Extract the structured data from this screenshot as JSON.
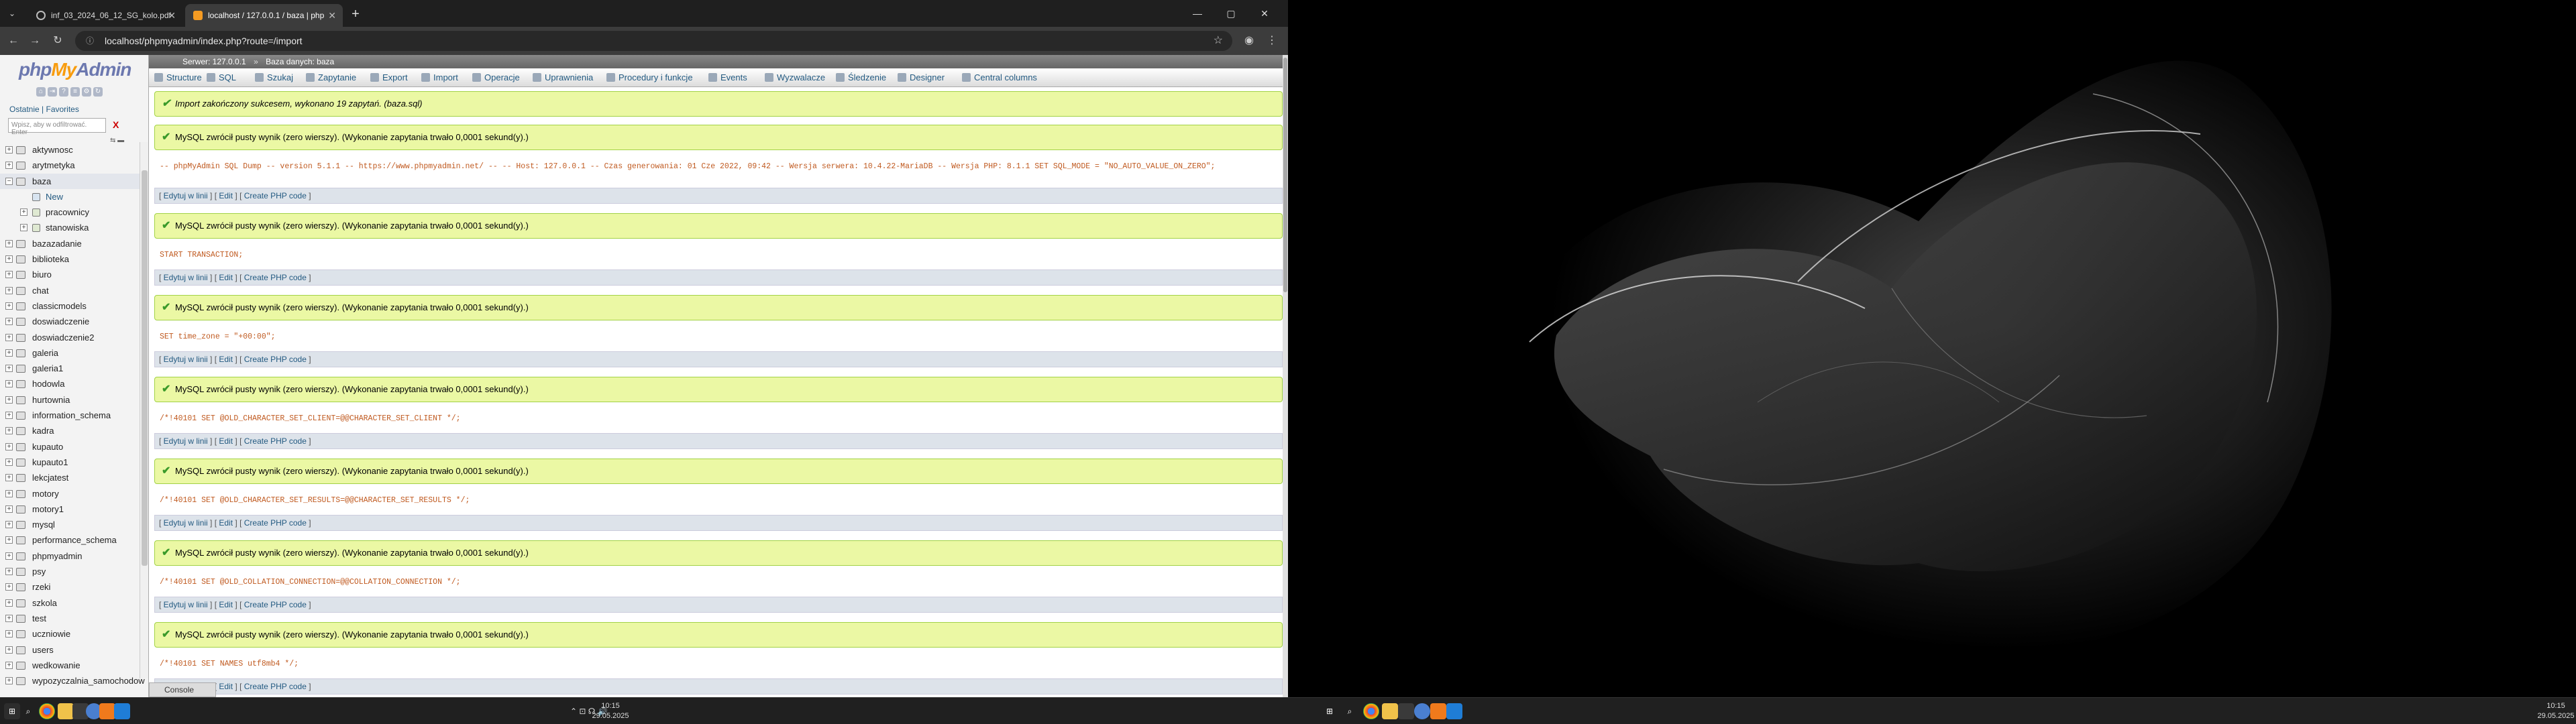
{
  "browser": {
    "tabs": [
      {
        "title": "inf_03_2024_06_12_SG_kolo.pdf"
      },
      {
        "title": "localhost / 127.0.0.1 / baza | php"
      }
    ],
    "url": "localhost/phpmyadmin/index.php?route=/import"
  },
  "sidebar": {
    "logo_php": "php",
    "logo_my": "My",
    "logo_admin": "Admin",
    "tab_recent": "Ostatnie",
    "tab_favorites": "Favorites",
    "filter_placeholder": "Wpisz, aby w odfiltrować. Enter",
    "filter_clear": "X",
    "databases": [
      {
        "name": "aktywnosc",
        "type": "db"
      },
      {
        "name": "arytmetyka",
        "type": "db"
      },
      {
        "name": "baza",
        "type": "db",
        "selected": true
      },
      {
        "name": "New",
        "type": "new"
      },
      {
        "name": "pracownicy",
        "type": "table"
      },
      {
        "name": "stanowiska",
        "type": "table"
      },
      {
        "name": "bazazadanie",
        "type": "db"
      },
      {
        "name": "biblioteka",
        "type": "db"
      },
      {
        "name": "biuro",
        "type": "db"
      },
      {
        "name": "chat",
        "type": "db"
      },
      {
        "name": "classicmodels",
        "type": "db"
      },
      {
        "name": "doswiadczenie",
        "type": "db"
      },
      {
        "name": "doswiadczenie2",
        "type": "db"
      },
      {
        "name": "galeria",
        "type": "db"
      },
      {
        "name": "galeria1",
        "type": "db"
      },
      {
        "name": "hodowla",
        "type": "db"
      },
      {
        "name": "hurtownia",
        "type": "db"
      },
      {
        "name": "information_schema",
        "type": "db"
      },
      {
        "name": "kadra",
        "type": "db"
      },
      {
        "name": "kupauto",
        "type": "db"
      },
      {
        "name": "kupauto1",
        "type": "db"
      },
      {
        "name": "lekcjatest",
        "type": "db"
      },
      {
        "name": "motory",
        "type": "db"
      },
      {
        "name": "motory1",
        "type": "db"
      },
      {
        "name": "mysql",
        "type": "db"
      },
      {
        "name": "performance_schema",
        "type": "db"
      },
      {
        "name": "phpmyadmin",
        "type": "db"
      },
      {
        "name": "psy",
        "type": "db"
      },
      {
        "name": "rzeki",
        "type": "db"
      },
      {
        "name": "szkola",
        "type": "db"
      },
      {
        "name": "test",
        "type": "db"
      },
      {
        "name": "uczniowie",
        "type": "db"
      },
      {
        "name": "users",
        "type": "db"
      },
      {
        "name": "wedkowanie",
        "type": "db"
      },
      {
        "name": "wypozyczalnia_samochodow",
        "type": "db"
      }
    ]
  },
  "breadcrumb": {
    "server": "Serwer: 127.0.0.1",
    "database": "Baza danych: baza"
  },
  "topmenu": [
    {
      "label": "Structure",
      "x": 0
    },
    {
      "label": "SQL"
    },
    {
      "label": "Szukaj"
    },
    {
      "label": "Zapytanie"
    },
    {
      "label": "Export"
    },
    {
      "label": "Import"
    },
    {
      "label": "Operacje"
    },
    {
      "label": "Uprawnienia"
    },
    {
      "label": "Procedury i funkcje"
    },
    {
      "label": "Events"
    },
    {
      "label": "Wyzwalacze"
    },
    {
      "label": "Śledzenie"
    },
    {
      "label": "Designer"
    },
    {
      "label": "Central columns"
    }
  ],
  "import_notice": "Import zakończony sukcesem, wykonano 19 zapytań. (baza.sql)",
  "query_results": [
    {
      "message": "MySQL zwrócił pusty wynik (zero wierszy). (Wykonanie zapytania trwało 0,0001 sekund(y).)",
      "sql": "-- phpMyAdmin SQL Dump -- version 5.1.1 -- https://www.phpmyadmin.net/ -- -- Host: 127.0.0.1 -- Czas generowania: 01 Cze 2022, 09:42 -- Wersja serwera: 10.4.22-MariaDB -- Wersja PHP: 8.1.1 SET SQL_MODE = \"NO_AUTO_VALUE_ON_ZERO\";"
    },
    {
      "message": "MySQL zwrócił pusty wynik (zero wierszy). (Wykonanie zapytania trwało 0,0001 sekund(y).)",
      "sql": "START TRANSACTION;"
    },
    {
      "message": "MySQL zwrócił pusty wynik (zero wierszy). (Wykonanie zapytania trwało 0,0001 sekund(y).)",
      "sql": "SET time_zone = \"+00:00\";"
    },
    {
      "message": "MySQL zwrócił pusty wynik (zero wierszy). (Wykonanie zapytania trwało 0,0001 sekund(y).)",
      "sql": "/*!40101 SET @OLD_CHARACTER_SET_CLIENT=@@CHARACTER_SET_CLIENT */;"
    },
    {
      "message": "MySQL zwrócił pusty wynik (zero wierszy). (Wykonanie zapytania trwało 0,0001 sekund(y).)",
      "sql": "/*!40101 SET @OLD_CHARACTER_SET_RESULTS=@@CHARACTER_SET_RESULTS */;"
    },
    {
      "message": "MySQL zwrócił pusty wynik (zero wierszy). (Wykonanie zapytania trwało 0,0001 sekund(y).)",
      "sql": "/*!40101 SET @OLD_COLLATION_CONNECTION=@@COLLATION_CONNECTION */;"
    },
    {
      "message": "MySQL zwrócił pusty wynik (zero wierszy). (Wykonanie zapytania trwało 0,0001 sekund(y).)",
      "sql": "/*!40101 SET NAMES utf8mb4 */;"
    }
  ],
  "tools": {
    "edit_inline": "Edytuj w linii",
    "edit": "Edit",
    "create_php": "Create PHP code"
  },
  "console_label": "Console",
  "taskbar": {
    "left_time": "10:15",
    "left_date": "29.05.2025",
    "right_time": "10:15",
    "right_date": "29.05.2025"
  },
  "colors": {
    "notice_bg": "#ebf8a4",
    "notice_border": "#a2d246",
    "link": "#235a81",
    "sql_text": "#c05a20"
  }
}
